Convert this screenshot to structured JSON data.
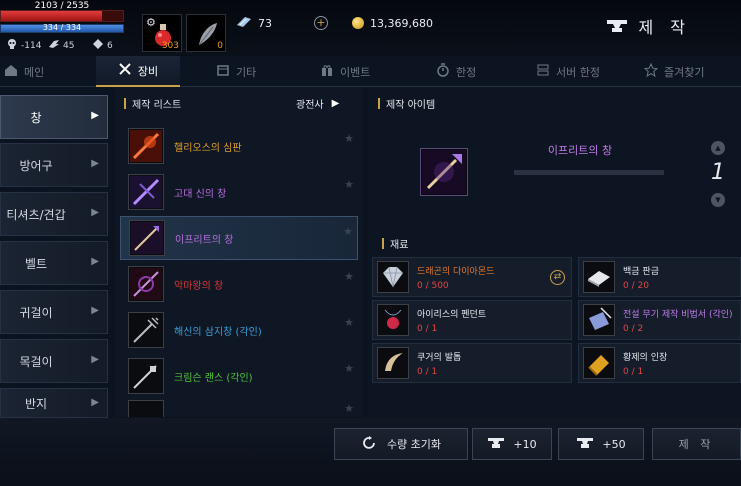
{
  "hud": {
    "hp_text": "2103 / 2535",
    "hp_fraction": 0.83,
    "mp_text": "334 / 334",
    "mp_fraction": 1.0,
    "stats": [
      {
        "icon": "skull-icon",
        "value": "-114"
      },
      {
        "icon": "wing-icon",
        "value": "45"
      },
      {
        "icon": "wing-double-icon",
        "value": "6"
      }
    ],
    "potion_count": "303",
    "feather_count": "0",
    "crystal_count": "73",
    "gold": "13,369,680",
    "page_title": "제 작"
  },
  "tabs": [
    {
      "label": "메인",
      "icon": "home-icon"
    },
    {
      "label": "장비",
      "icon": "crossed-swords-icon"
    },
    {
      "label": "기타",
      "icon": "box-icon"
    },
    {
      "label": "이벤트",
      "icon": "gift-icon"
    },
    {
      "label": "한정",
      "icon": "timer-icon"
    },
    {
      "label": "서버 한정",
      "icon": "server-icon"
    },
    {
      "label": "즐겨찾기",
      "icon": "star-icon"
    }
  ],
  "categories": [
    {
      "label": "창"
    },
    {
      "label": "방어구"
    },
    {
      "label": "티셔츠/견갑"
    },
    {
      "label": "벨트"
    },
    {
      "label": "귀걸이"
    },
    {
      "label": "목걸이"
    },
    {
      "label": "반지"
    }
  ],
  "list": {
    "header": "제작 리스트",
    "filter": "광전사",
    "items": [
      {
        "name": "헬리오스의 심판",
        "color": "#e0a22a"
      },
      {
        "name": "고대 신의 창",
        "color": "#b86fe0"
      },
      {
        "name": "이프리트의 창",
        "color": "#b86fe0"
      },
      {
        "name": "악마왕의 창",
        "color": "#d83a3a"
      },
      {
        "name": "해신의 삼지창 (각인)",
        "color": "#3aa0d8"
      },
      {
        "name": "크림슨 랜스 (각인)",
        "color": "#52c23a"
      }
    ]
  },
  "detail": {
    "header": "제작 아이템",
    "item_name": "이프리트의 창",
    "quantity": "1",
    "materials_header": "재료",
    "materials": [
      {
        "name": "드래곤의 다이아몬드",
        "count": "0 / 500",
        "color": "#e07a2a"
      },
      {
        "name": "백금 판금",
        "count": "0 / 20",
        "color": "#e6e9ee"
      },
      {
        "name": "아이리스의 펜던트",
        "count": "0 / 1",
        "color": "#e6e9ee"
      },
      {
        "name": "전설 무기 제작 비법서 (각인)",
        "count": "0 / 2",
        "color": "#c07ce8"
      },
      {
        "name": "쿠거의 발톱",
        "count": "0 / 1",
        "color": "#e6e9ee"
      },
      {
        "name": "황제의 인장",
        "count": "0 / 1",
        "color": "#e6e9ee"
      }
    ]
  },
  "bottom": {
    "reset_label": "수량 초기화",
    "plus10_label": "+10",
    "plus50_label": "+50",
    "craft_label": "제 작"
  }
}
